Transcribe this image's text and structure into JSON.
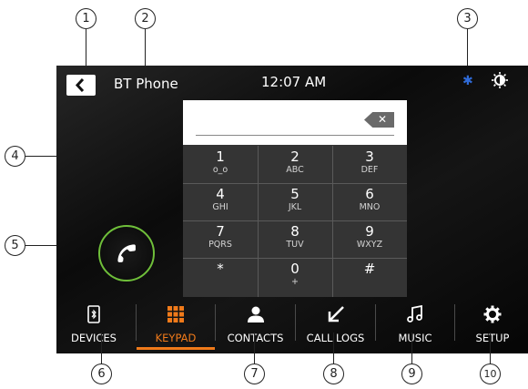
{
  "header": {
    "back_label": "back",
    "app_title": "BT Phone",
    "clock": "12:07 AM",
    "bluetooth_glyph": "✱"
  },
  "dialpad": {
    "backspace_glyph": "✕",
    "keys": [
      {
        "digit": "1",
        "letters": "ᴏ_ᴏ"
      },
      {
        "digit": "2",
        "letters": "ABC"
      },
      {
        "digit": "3",
        "letters": "DEF"
      },
      {
        "digit": "4",
        "letters": "GHI"
      },
      {
        "digit": "5",
        "letters": "JKL"
      },
      {
        "digit": "6",
        "letters": "MNO"
      },
      {
        "digit": "7",
        "letters": "PQRS"
      },
      {
        "digit": "8",
        "letters": "TUV"
      },
      {
        "digit": "9",
        "letters": "WXYZ"
      },
      {
        "digit": "*",
        "letters": ""
      },
      {
        "digit": "0",
        "letters": "+"
      },
      {
        "digit": "#",
        "letters": ""
      }
    ]
  },
  "nav": {
    "items": [
      {
        "label": "DEVICES",
        "icon": "phone-bluetooth-icon"
      },
      {
        "label": "KEYPAD",
        "icon": "keypad-grid-icon",
        "active": true
      },
      {
        "label": "CONTACTS",
        "icon": "person-icon"
      },
      {
        "label": "CALL LOGS",
        "icon": "call-log-arrow-icon"
      },
      {
        "label": "MUSIC",
        "icon": "music-note-icon"
      },
      {
        "label": "SETUP",
        "icon": "gear-icon"
      }
    ]
  },
  "callouts": [
    "1",
    "2",
    "3",
    "4",
    "5",
    "6",
    "7",
    "8",
    "9",
    "10"
  ],
  "colors": {
    "accent": "#f07a1a",
    "call_ring": "#6fbf3a",
    "bluetooth": "#2f6bd8"
  }
}
